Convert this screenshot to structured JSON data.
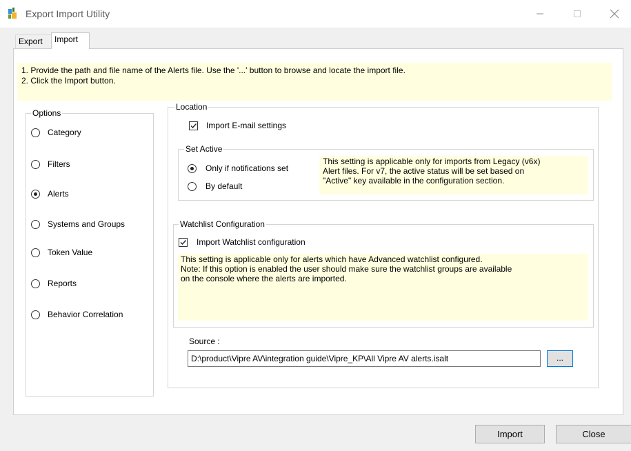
{
  "window": {
    "title": "Export Import Utility",
    "minimize_icon": "minimize-icon",
    "maximize_icon": "maximize-icon",
    "close_icon": "close-icon"
  },
  "tabs": [
    {
      "label": "Export",
      "selected": false
    },
    {
      "label": "Import",
      "selected": true
    }
  ],
  "instructions": [
    "1. Provide the path and file name of the Alerts file. Use the '...' button to browse and locate the import file.",
    "2. Click the Import button."
  ],
  "options": {
    "legend": "Options",
    "items": [
      {
        "label": "Category",
        "selected": false
      },
      {
        "label": "Filters",
        "selected": false
      },
      {
        "label": "Alerts",
        "selected": true
      },
      {
        "label": "Systems and Groups",
        "selected": false
      },
      {
        "label": "Token Value",
        "selected": false
      },
      {
        "label": "Reports",
        "selected": false
      },
      {
        "label": "Behavior Correlation",
        "selected": false
      }
    ]
  },
  "location": {
    "legend": "Location",
    "import_email": {
      "label": "Import E-mail settings",
      "checked": true
    },
    "set_active": {
      "legend": "Set Active",
      "options": [
        {
          "label": "Only if notifications set",
          "selected": true
        },
        {
          "label": "By default",
          "selected": false
        }
      ],
      "note": [
        "This setting is applicable only for imports from Legacy (v6x)",
        "Alert files. For v7, the active status will be set based on",
        "\"Active\" key available in the configuration section."
      ]
    },
    "watchlist": {
      "legend": "Watchlist Configuration",
      "checkbox": {
        "label": "Import Watchlist configuration",
        "checked": true
      },
      "note": [
        "This setting is applicable only for alerts which have Advanced watchlist configured.",
        "Note: If this option is enabled the user should make sure the watchlist groups are available",
        "on the console where the alerts are imported."
      ]
    },
    "source": {
      "label": "Source :",
      "value": "D:\\product\\Vipre AV\\integration guide\\Vipre_KP\\All Vipre AV alerts.isalt",
      "browse_label": "..."
    }
  },
  "buttons": {
    "import": "Import",
    "close": "Close"
  },
  "colors": {
    "note_background": "#ffffe0",
    "focus_border": "#0078d7"
  }
}
